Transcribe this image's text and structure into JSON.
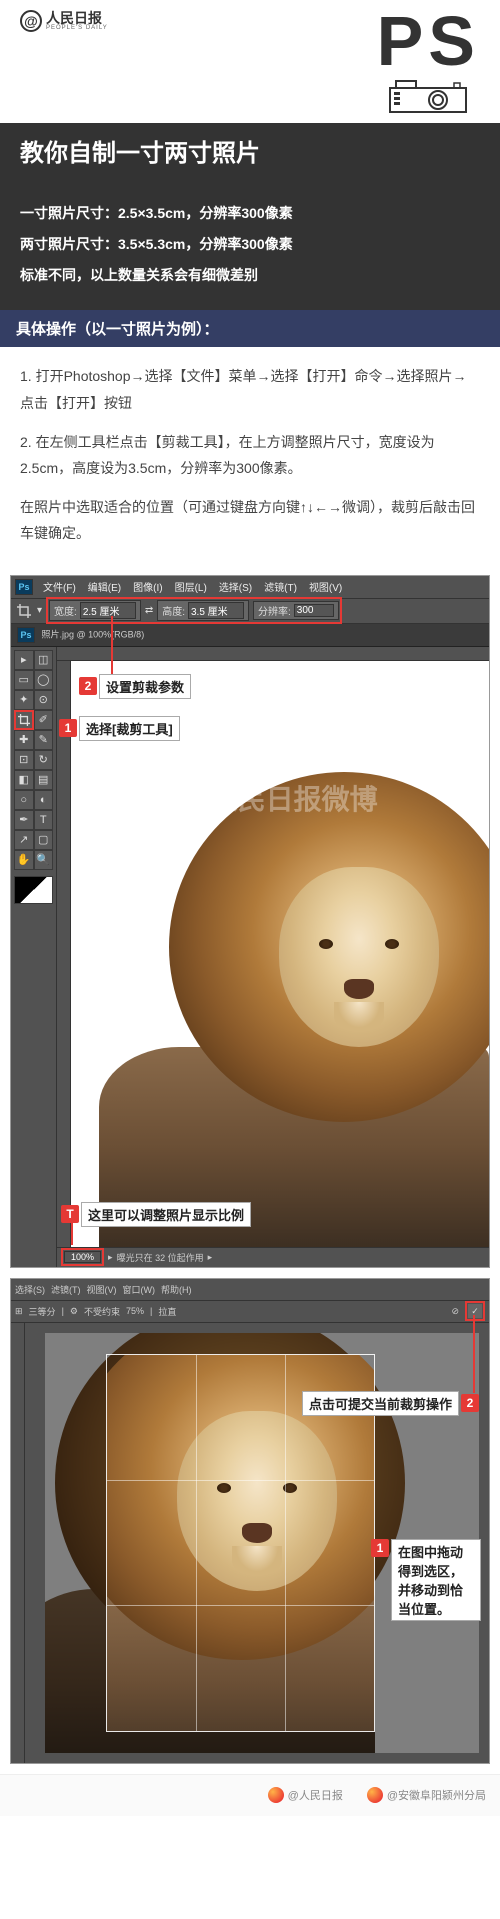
{
  "header": {
    "at": "@",
    "logo_cn": "人民日报",
    "logo_en": "PEOPLE'S DAILY",
    "ps_label": "PS"
  },
  "title": "教你自制一寸两寸照片",
  "specs": {
    "one_inch": "一寸照片尺寸：2.5×3.5cm，分辨率300像素",
    "two_inch": "两寸照片尺寸：3.5×5.3cm，分辨率300像素",
    "note": "标准不同，以上数量关系会有细微差别"
  },
  "section_label": "具体操作（以一寸照片为例）：",
  "steps": {
    "s1": "1. 打开Photoshop→选择【文件】菜单→选择【打开】命令→选择照片→点击【打开】按钮",
    "s2": "2. 在左侧工具栏点击【剪裁工具】，在上方调整照片尺寸，宽度设为2.5cm，高度设为3.5cm，分辨率为300像素。",
    "s3": "在照片中选取适合的位置（可通过键盘方向键↑↓←→微调），裁剪后敲击回车键确定。"
  },
  "ps1": {
    "logo": "Ps",
    "menu": [
      "文件(F)",
      "编辑(E)",
      "图像(I)",
      "图层(L)",
      "选择(S)",
      "滤镜(T)",
      "视图(V)"
    ],
    "width_label": "宽度:",
    "width_val": "2.5 厘米",
    "swap": "⇄",
    "height_label": "高度:",
    "height_val": "3.5 厘米",
    "res_label": "分辨率:",
    "res_val": "300",
    "tab": "照片.jpg @ 100%(RGB/8)",
    "zoom": "100%",
    "status": "曝光只在 32 位起作用",
    "watermark": "@人民日报微博",
    "callout1": "选择[裁剪工具]",
    "callout2": "设置剪裁参数",
    "calloutT": "这里可以调整照片显示比例",
    "badge1": "1",
    "badge2": "2",
    "badgeT": "T"
  },
  "ps2": {
    "opts": [
      "选择(S)",
      "滤镜(T)",
      "视图(V)",
      "窗口(W)",
      "帮助(H)"
    ],
    "opts2_label": "三等分",
    "opts2_label2": "不受约束",
    "opts2_pct": "75%",
    "opts2_straight": "拉直",
    "confirm": "✓",
    "callout1": "在图中拖动得到选区，并移动到恰当位置。",
    "callout2": "点击可提交当前裁剪操作",
    "badge1": "1",
    "badge2": "2"
  },
  "footer": {
    "item1": "@人民日报",
    "item2": "@安徽阜阳颍州分局"
  }
}
